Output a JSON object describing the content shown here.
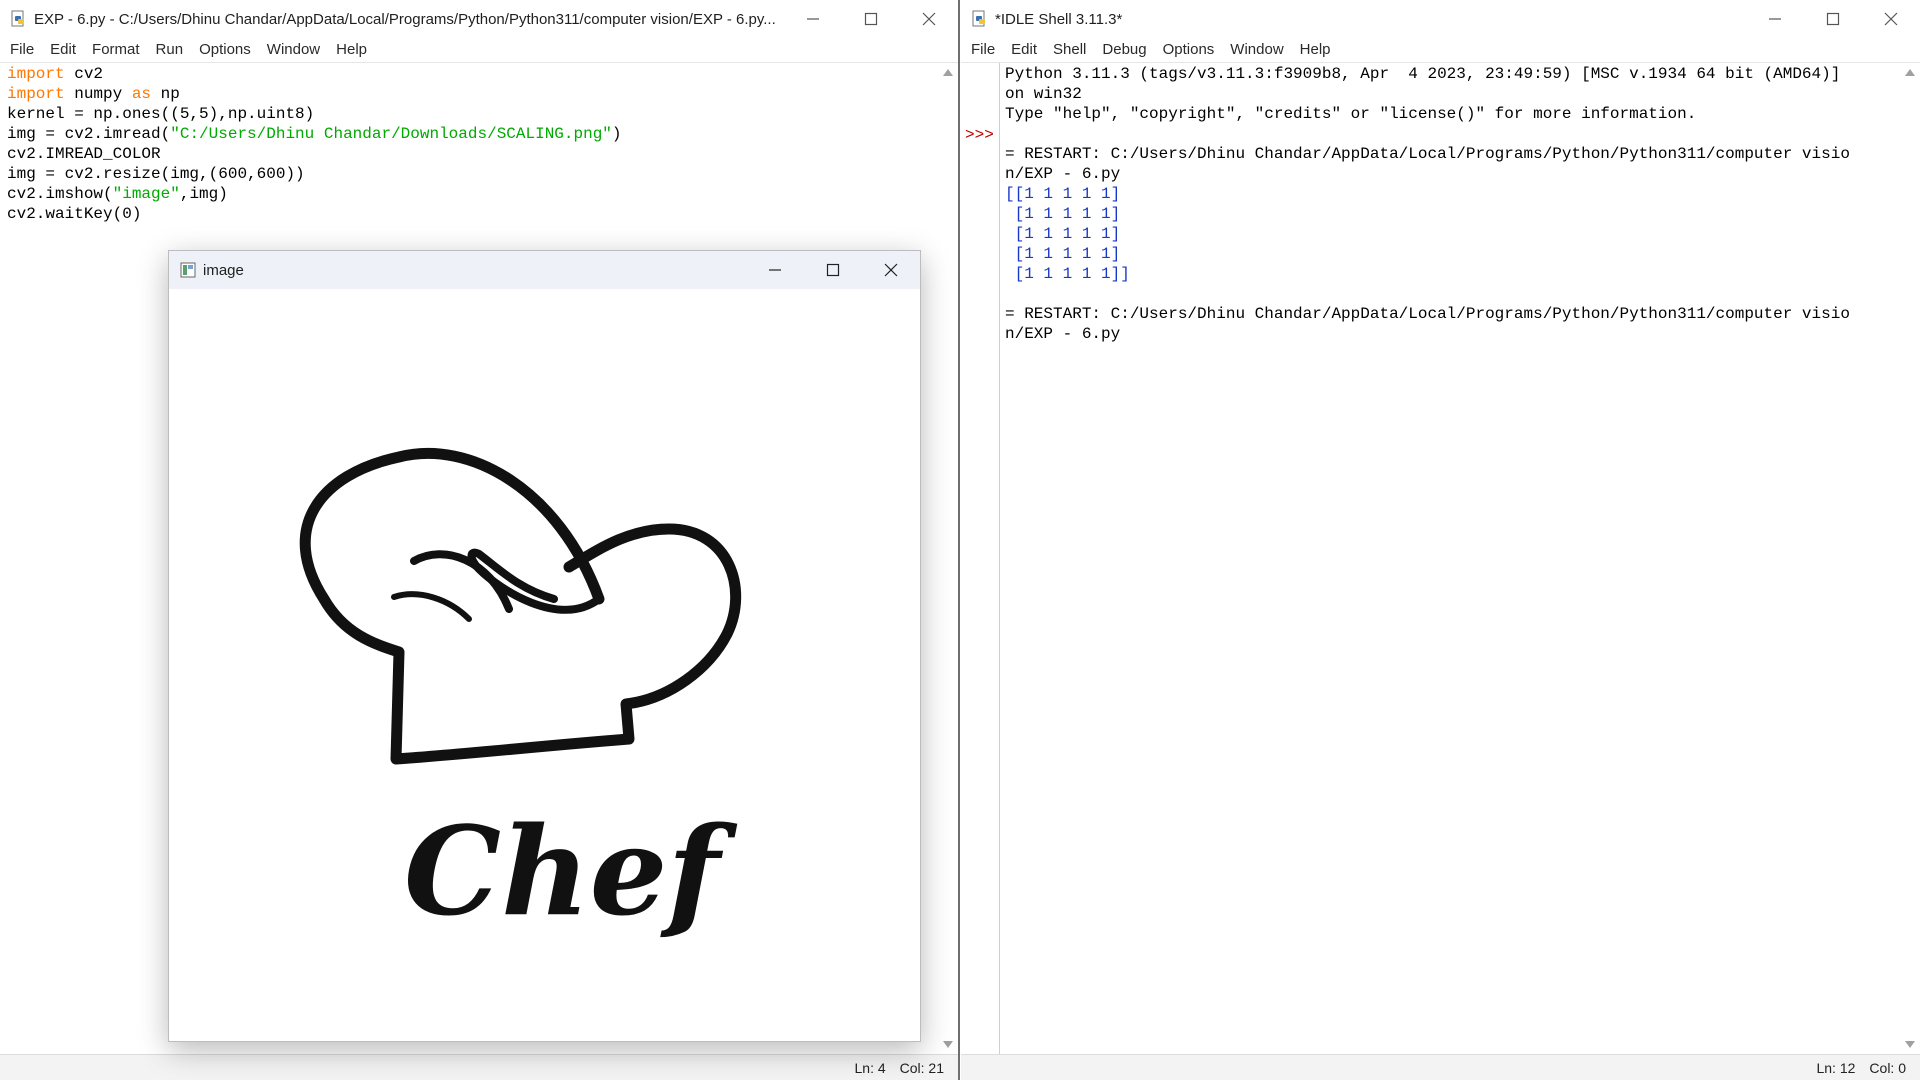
{
  "editor": {
    "title": "EXP - 6.py - C:/Users/Dhinu Chandar/AppData/Local/Programs/Python/Python311/computer vision/EXP - 6.py...",
    "menu": [
      "File",
      "Edit",
      "Format",
      "Run",
      "Options",
      "Window",
      "Help"
    ],
    "code": {
      "l1_kw": "import",
      "l1_rest": " cv2",
      "l2_kw": "import",
      "l2_mid": " numpy ",
      "l2_as": "as",
      "l2_rest": " np",
      "l3": "kernel = np.ones((5,5),np.uint8)",
      "l4_a": "img = cv2.imread(",
      "l4_str": "\"C:/Users/Dhinu Chandar/Downloads/SCALING.png\"",
      "l4_b": ")",
      "l5": "cv2.IMREAD_COLOR",
      "l6": "img = cv2.resize(img,(600,600))",
      "l7_a": "cv2.imshow(",
      "l7_str": "\"image\"",
      "l7_b": ",img)",
      "l8": "cv2.waitKey(0)"
    },
    "status": {
      "line": "Ln: 4",
      "col": "Col: 21"
    }
  },
  "image_window": {
    "title": "image",
    "logo_text": "Chef"
  },
  "shell": {
    "title": "*IDLE Shell 3.11.3*",
    "menu": [
      "File",
      "Edit",
      "Shell",
      "Debug",
      "Options",
      "Window",
      "Help"
    ],
    "prompt": ">>>",
    "output": {
      "l1": "Python 3.11.3 (tags/v3.11.3:f3909b8, Apr  4 2023, 23:49:59) [MSC v.1934 64 bit (AMD64)]",
      "l2": "on win32",
      "l3": "Type \"help\", \"copyright\", \"credits\" or \"license()\" for more information.",
      "l4": "",
      "l5": "= RESTART: C:/Users/Dhinu Chandar/AppData/Local/Programs/Python/Python311/computer visio",
      "l6": "n/EXP - 6.py",
      "arr": [
        "[[1 1 1 1 1]",
        " [1 1 1 1 1]",
        " [1 1 1 1 1]",
        " [1 1 1 1 1]",
        " [1 1 1 1 1]]"
      ],
      "l12": "= RESTART: C:/Users/Dhinu Chandar/AppData/Local/Programs/Python/Python311/computer visio",
      "l13": "n/EXP - 6.py"
    },
    "status": {
      "line": "Ln: 12",
      "col": "Col: 0"
    }
  }
}
